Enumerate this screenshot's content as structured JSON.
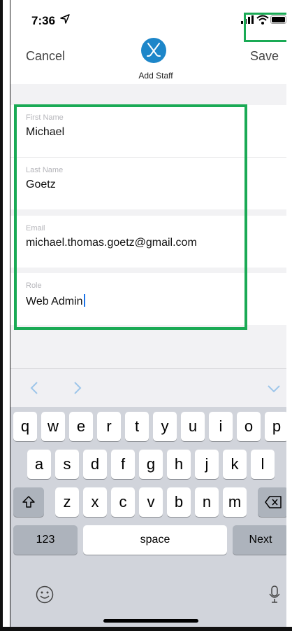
{
  "status_bar": {
    "time": "7:36"
  },
  "nav": {
    "cancel_label": "Cancel",
    "title": "Add Staff",
    "save_label": "Save"
  },
  "form": {
    "fields": [
      {
        "label": "First Name",
        "value": "Michael"
      },
      {
        "label": "Last Name",
        "value": "Goetz"
      },
      {
        "label": "Email",
        "value": "michael.thomas.goetz@gmail.com"
      },
      {
        "label": "Role",
        "value": "Web Admin"
      }
    ]
  },
  "keyboard": {
    "row1": [
      "q",
      "w",
      "e",
      "r",
      "t",
      "y",
      "u",
      "i",
      "o",
      "p"
    ],
    "row2": [
      "a",
      "s",
      "d",
      "f",
      "g",
      "h",
      "j",
      "k",
      "l"
    ],
    "row3": [
      "z",
      "x",
      "c",
      "v",
      "b",
      "n",
      "m"
    ],
    "numbers_label": "123",
    "space_label": "space",
    "next_label": "Next"
  },
  "colors": {
    "accent": "#1d86c9",
    "highlight": "#1aaa55"
  }
}
